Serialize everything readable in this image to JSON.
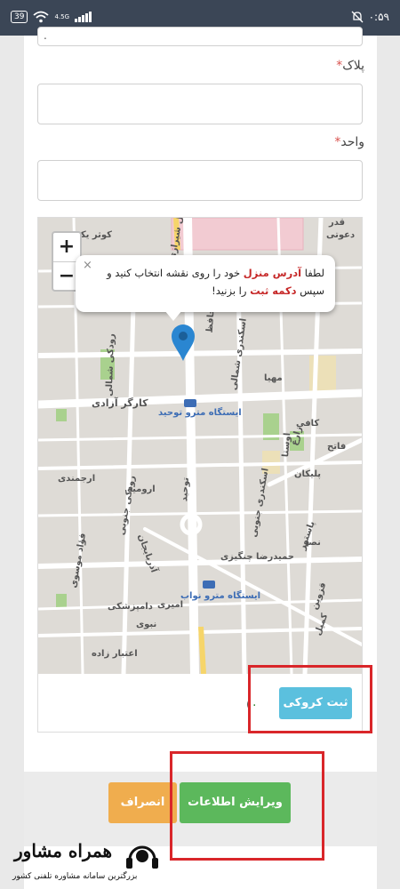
{
  "status_bar": {
    "battery": "39",
    "network": "4.5G",
    "time": "۰:۵۹"
  },
  "form": {
    "top_field_value": ".",
    "plate_label": "پلاک",
    "unit_label": "واحد",
    "required_mark": "*"
  },
  "map": {
    "zoom_in": "+",
    "zoom_out": "−",
    "popup": {
      "close": "×",
      "part1": "لطفا ",
      "highlight1": "آدرس منزل",
      "part2": " خود را روی نقشه انتخاب کنید و سپس ",
      "highlight2": "دکمه ثبت",
      "part3": " را بزنید!"
    },
    "labels": [
      "کوثر یکم",
      "قدر",
      "دعوتی",
      "وصال شیرازی",
      "حافظ",
      "رودکی شمالی",
      "اسکندری شمالی",
      "مهیا",
      "کارگر آزادی",
      "ایستگاه مترو توحید",
      "کافی",
      "اوستا",
      "پلیکان",
      "فاتح",
      "ارجمندی",
      "ارومیه",
      "توحید",
      "رودکی جنوبی",
      "اسکندری جنوبی",
      "آذربایجان",
      "حمیدرضا چنگیزی",
      "پاستور",
      "نصر",
      "فؤاد موسوی",
      "ایستگاه مترو نواب",
      "دامپزشکی",
      "امیری",
      "نبوی",
      "اعتبار زاده",
      "قزوین",
      "کمیل",
      "زارع"
    ]
  },
  "buttons": {
    "register_sketch": "ثبت کروکی",
    "coords_fragment": "(",
    "coords_value": "۰",
    "edit_info": "ویرایش اطلاعات",
    "cancel": "انصراف"
  },
  "colors": {
    "statusbar": "#3b4656",
    "info_button": "#5bc0de",
    "success_button": "#5cb85c",
    "warning_button": "#f0ad4e",
    "highlight_box": "#d9262a",
    "map_pin": "#2a86d1"
  },
  "watermark": {
    "brand": "همراه مشاور",
    "tagline": "بزرگترین سامانه مشاوره تلفنی کشور"
  }
}
